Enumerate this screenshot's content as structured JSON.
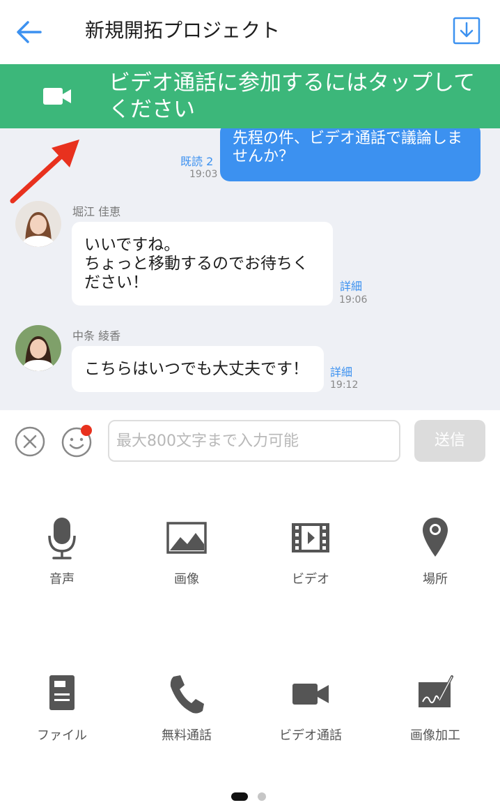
{
  "header": {
    "title": "新規開拓プロジェクト",
    "back_icon": "arrow-left-icon",
    "download_icon": "download-icon",
    "accent_color": "#3c91f0"
  },
  "banner": {
    "text": "ビデオ通話に参加するにはタップしてください",
    "icon": "video-camera-icon",
    "color": "#3cb77a"
  },
  "messages": [
    {
      "direction": "out",
      "text": "先程の件、ビデオ通話で議論しませんか？",
      "read": "既読 2",
      "time": "19:03"
    },
    {
      "direction": "in",
      "sender": "堀江 佳恵",
      "text": "いいですね。\nちょっと移動するのでお待ちください！",
      "detail": "詳細",
      "time": "19:06"
    },
    {
      "direction": "in",
      "sender": "中条 綾香",
      "text": "こちらはいつでも大丈夫です！",
      "detail": "詳細",
      "time": "19:12"
    }
  ],
  "input": {
    "placeholder": "最大800文字まで入力可能",
    "value": "",
    "send_label": "送信",
    "close_icon": "close-circle-icon",
    "emoji_icon": "smiley-icon"
  },
  "tools": [
    {
      "label": "音声",
      "icon": "microphone-icon"
    },
    {
      "label": "画像",
      "icon": "image-icon"
    },
    {
      "label": "ビデオ",
      "icon": "film-icon"
    },
    {
      "label": "場所",
      "icon": "location-pin-icon"
    },
    {
      "label": "ファイル",
      "icon": "file-icon"
    },
    {
      "label": "無料通話",
      "icon": "phone-icon"
    },
    {
      "label": "ビデオ通話",
      "icon": "video-camera-icon"
    },
    {
      "label": "画像加工",
      "icon": "image-edit-icon"
    }
  ],
  "pager": {
    "total": 2,
    "active": 1
  }
}
